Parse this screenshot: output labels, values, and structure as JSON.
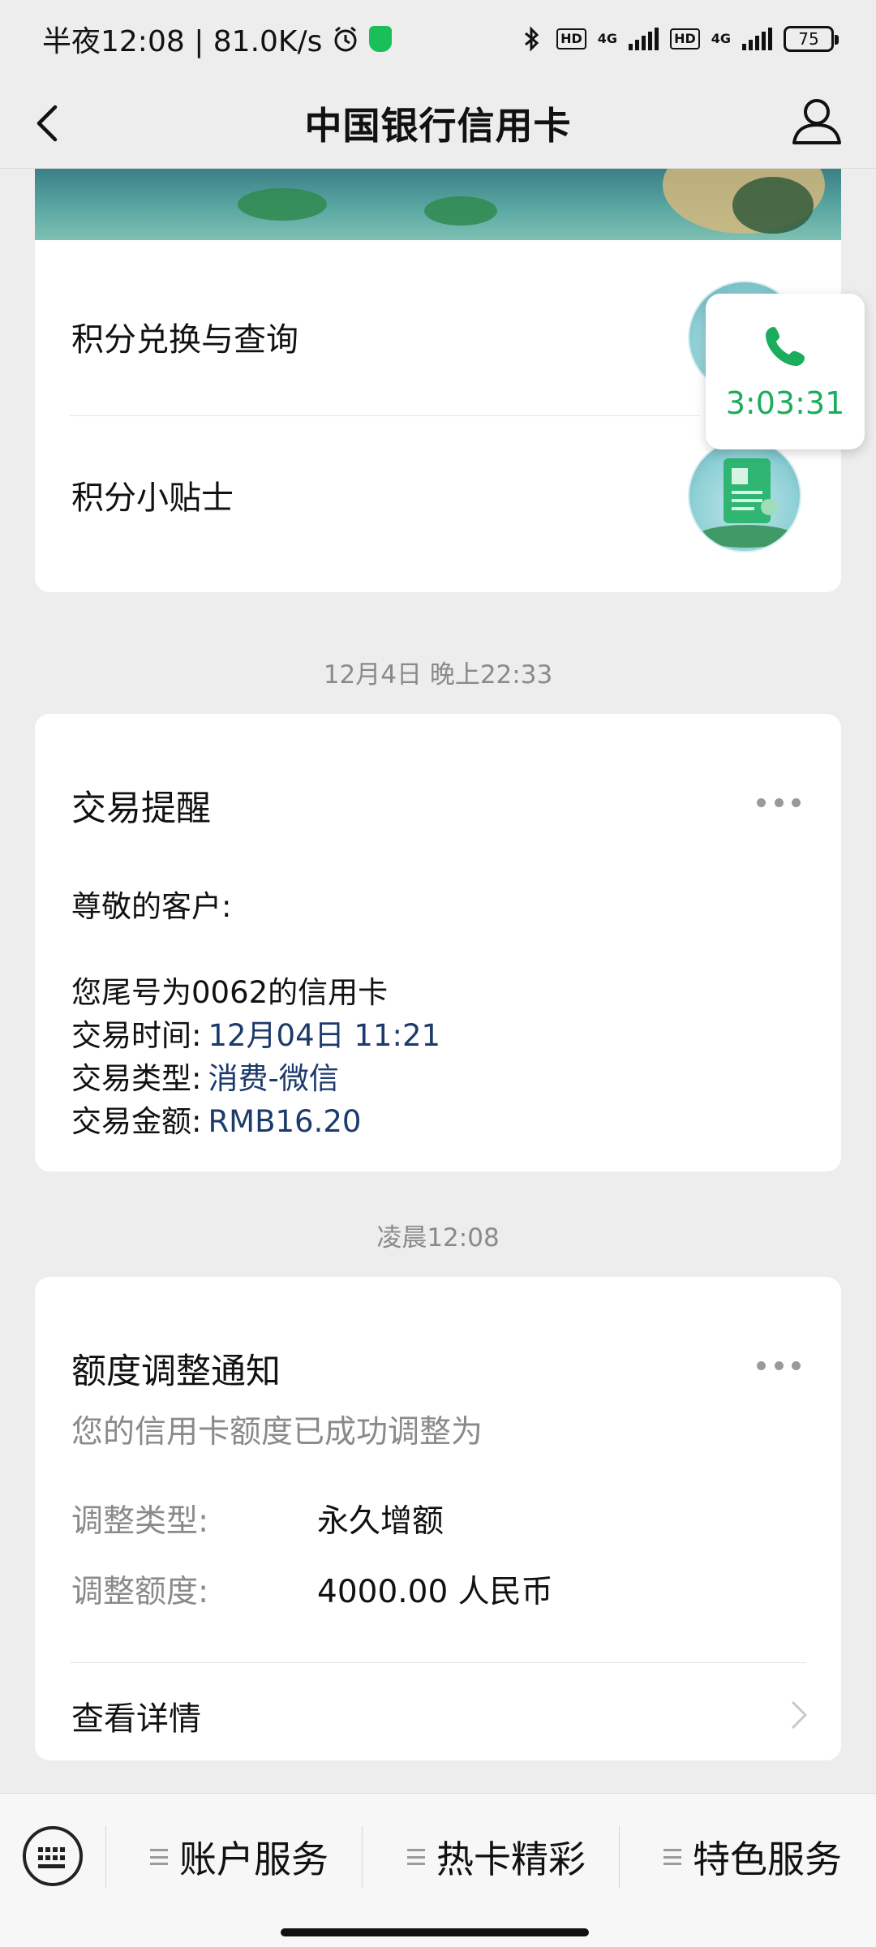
{
  "status_bar": {
    "time_speed": "半夜12:08 | 81.0K/s",
    "hd1": "HD",
    "net1": "4G",
    "hd2": "HD",
    "net2": "4G",
    "battery": "75"
  },
  "nav": {
    "title": "中国银行信用卡"
  },
  "points_menu": {
    "items": [
      {
        "label": "积分兑换与查询"
      },
      {
        "label": "积分小贴士"
      }
    ]
  },
  "call_float": {
    "duration": "3:03:31"
  },
  "messages": [
    {
      "timestamp": "12月4日 晚上22:33",
      "title": "交易提醒",
      "greeting": "尊敬的客户:",
      "intro": "您尾号为0062的信用卡",
      "rows": [
        {
          "label": "交易时间:",
          "value": "12月04日 11:21"
        },
        {
          "label": "交易类型:",
          "value": "消费-微信"
        },
        {
          "label": "交易金额:",
          "value": "RMB16.20"
        }
      ]
    },
    {
      "timestamp": "凌晨12:08",
      "title": "额度调整通知",
      "subtitle": "您的信用卡额度已成功调整为",
      "rows": [
        {
          "label": "调整类型:",
          "value": "永久增额"
        },
        {
          "label": "调整额度:",
          "value": "4000.00 人民币"
        }
      ],
      "detail_link": "查看详情"
    }
  ],
  "bottom_menu": {
    "items": [
      {
        "label": "账户服务"
      },
      {
        "label": "热卡精彩"
      },
      {
        "label": "特色服务"
      }
    ]
  },
  "colors": {
    "accent_green": "#1aad5c",
    "text_blue": "#1c3a6b",
    "background": "#ededed"
  }
}
